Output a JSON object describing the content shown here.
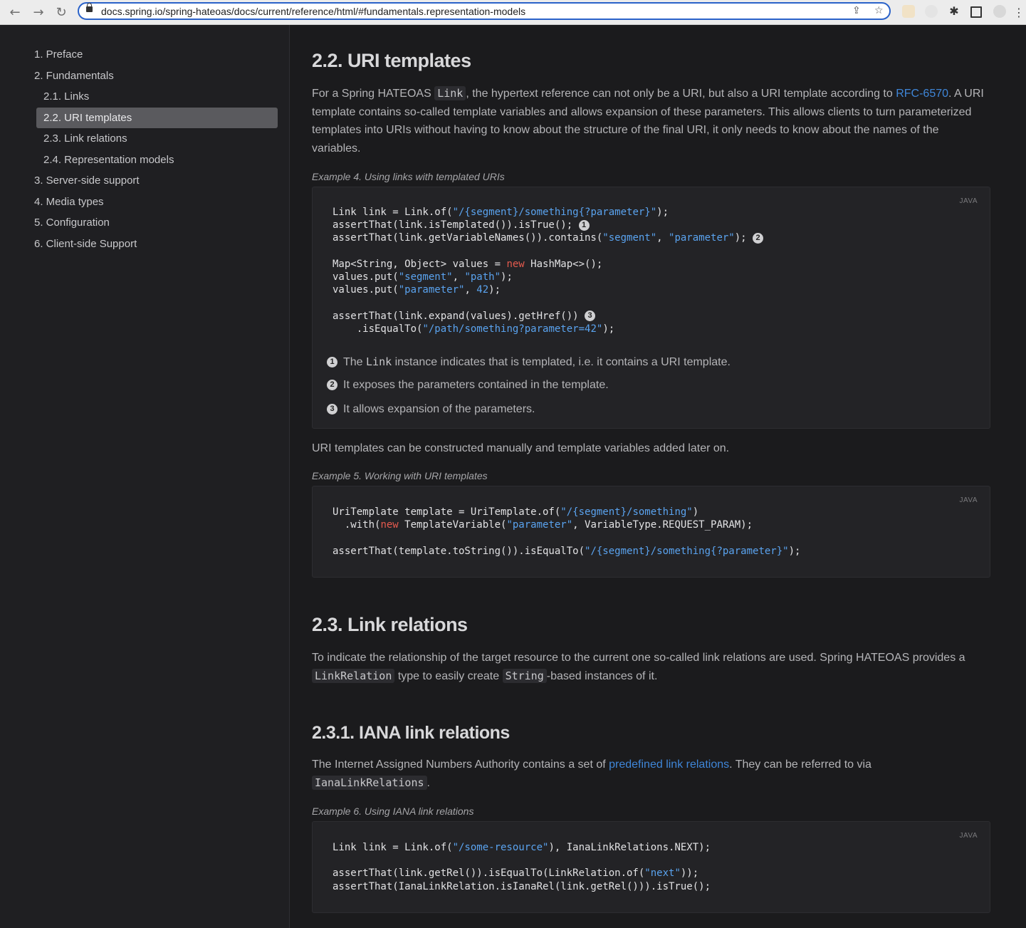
{
  "browser": {
    "url": "docs.spring.io/spring-hateoas/docs/current/reference/html/#fundamentals.representation-models"
  },
  "toc": [
    {
      "label": "1. Preface"
    },
    {
      "label": "2. Fundamentals"
    },
    {
      "label": "2.1. Links"
    },
    {
      "label": "2.2. URI templates"
    },
    {
      "label": "2.3. Link relations"
    },
    {
      "label": "2.4. Representation models"
    },
    {
      "label": "3. Server-side support"
    },
    {
      "label": "4. Media types"
    },
    {
      "label": "5. Configuration"
    },
    {
      "label": "6. Client-side Support"
    }
  ],
  "sections": {
    "uri_templates": {
      "heading": "2.2. URI templates",
      "intro_1": "For a Spring HATEOAS ",
      "intro_code": "Link",
      "intro_2": ", the hypertext reference can not only be a URI, but also a URI template according to ",
      "intro_link": "RFC-6570",
      "intro_3": ". A URI template contains so-called template variables and allows expansion of these parameters. This allows clients to turn parameterized templates into URIs without having to know about the structure of the final URI, it only needs to know about the names of the variables.",
      "example4_caption": "Example 4. Using links with templated URIs",
      "example4_lang": "JAVA",
      "callouts": [
        {
          "num": "1",
          "pre": "The ",
          "code": "Link",
          "post": " instance indicates that is templated, i.e. it contains a URI template."
        },
        {
          "num": "2",
          "pre": "It exposes the parameters contained in the template.",
          "code": "",
          "post": ""
        },
        {
          "num": "3",
          "pre": "It allows expansion of the parameters.",
          "code": "",
          "post": ""
        }
      ],
      "after_text": "URI templates can be constructed manually and template variables added later on.",
      "example5_caption": "Example 5. Working with URI templates",
      "example5_lang": "JAVA"
    },
    "link_relations": {
      "heading": "2.3. Link relations",
      "text_1": "To indicate the relationship of the target resource to the current one so-called link relations are used. Spring HATEOAS provides a ",
      "code_1": "LinkRelation",
      "text_2": " type to easily create ",
      "code_2": "String",
      "text_3": "-based instances of it."
    },
    "iana": {
      "heading": "2.3.1. IANA link relations",
      "text_1": "The Internet Assigned Numbers Authority contains a set of ",
      "link": "predefined link relations",
      "text_2": ". They can be referred to via ",
      "code": "IanaLinkRelations",
      "text_3": ".",
      "example6_caption": "Example 6. Using IANA link relations",
      "example6_lang": "JAVA"
    }
  },
  "code": {
    "ex4": [
      [
        [
          "t",
          "Link link = Link.of("
        ],
        [
          "s",
          "\"/{segment}/something{?parameter}\""
        ],
        [
          "t",
          ");"
        ]
      ],
      [
        [
          "t",
          "assertThat(link.isTemplated()).isTrue(); "
        ],
        [
          "c",
          "1"
        ]
      ],
      [
        [
          "t",
          "assertThat(link.getVariableNames()).contains("
        ],
        [
          "s",
          "\"segment\""
        ],
        [
          "t",
          ", "
        ],
        [
          "s",
          "\"parameter\""
        ],
        [
          "t",
          "); "
        ],
        [
          "c",
          "2"
        ]
      ],
      [],
      [
        [
          "t",
          "Map<String, Object> values = "
        ],
        [
          "k",
          "new"
        ],
        [
          "t",
          " HashMap<>();"
        ]
      ],
      [
        [
          "t",
          "values.put("
        ],
        [
          "s",
          "\"segment\""
        ],
        [
          "t",
          ", "
        ],
        [
          "s",
          "\"path\""
        ],
        [
          "t",
          ");"
        ]
      ],
      [
        [
          "t",
          "values.put("
        ],
        [
          "s",
          "\"parameter\""
        ],
        [
          "t",
          ", "
        ],
        [
          "s",
          "42"
        ],
        [
          "t",
          ");"
        ]
      ],
      [],
      [
        [
          "t",
          "assertThat(link.expand(values).getHref()) "
        ],
        [
          "c",
          "3"
        ]
      ],
      [
        [
          "t",
          "    .isEqualTo("
        ],
        [
          "s",
          "\"/path/something?parameter=42\""
        ],
        [
          "t",
          ");"
        ]
      ]
    ],
    "ex5": [
      [
        [
          "t",
          "UriTemplate template = UriTemplate.of("
        ],
        [
          "s",
          "\"/{segment}/something\""
        ],
        [
          "t",
          ")"
        ]
      ],
      [
        [
          "t",
          "  .with("
        ],
        [
          "k",
          "new"
        ],
        [
          "t",
          " TemplateVariable("
        ],
        [
          "s",
          "\"parameter\""
        ],
        [
          "t",
          ", VariableType.REQUEST_PARAM);"
        ]
      ],
      [],
      [
        [
          "t",
          "assertThat(template.toString()).isEqualTo("
        ],
        [
          "s",
          "\"/{segment}/something{?parameter}\""
        ],
        [
          "t",
          ");"
        ]
      ]
    ],
    "ex6": [
      [
        [
          "t",
          "Link link = Link.of("
        ],
        [
          "s",
          "\"/some-resource\""
        ],
        [
          "t",
          "), IanaLinkRelations.NEXT);"
        ]
      ],
      [],
      [
        [
          "t",
          "assertThat(link.getRel()).isEqualTo(LinkRelation.of("
        ],
        [
          "s",
          "\"next\""
        ],
        [
          "t",
          "));"
        ]
      ],
      [
        [
          "t",
          "assertThat(IanaLinkRelation.isIanaRel(link.getRel())).isTrue();"
        ]
      ]
    ]
  }
}
